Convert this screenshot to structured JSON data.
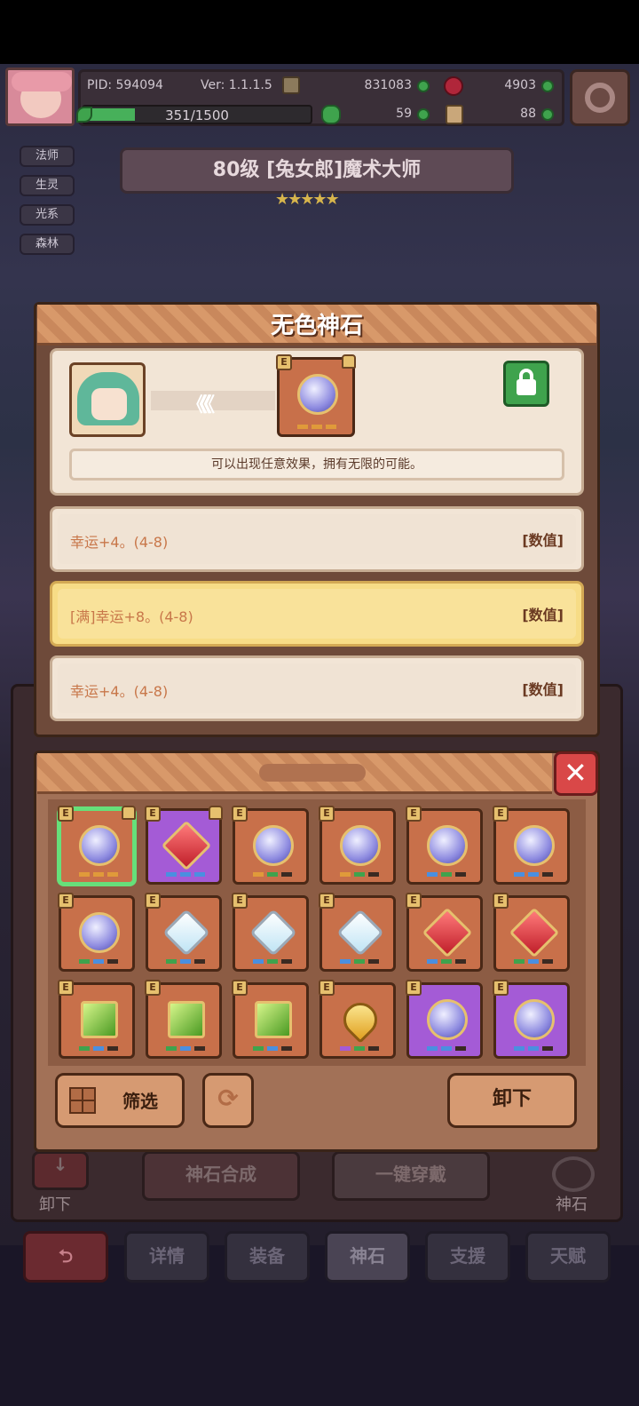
{
  "header": {
    "pid": "PID: 594094",
    "version": "Ver: 1.1.1.5",
    "gold": "831083",
    "gems": "4903",
    "xp": "351/1500",
    "clover": "59",
    "tickets": "88"
  },
  "tags": [
    "法师",
    "生灵",
    "光系",
    "森林"
  ],
  "hero_title": "80级 [兔女郎]魔术大师",
  "stars": "★★★★★",
  "stone_modal": {
    "title": "无色神石",
    "arrows": "《《《",
    "description": "可以出现任意效果，拥有无限的可能。",
    "affixes": [
      {
        "text": "幸运+4。(4-8)",
        "tag": "[数值]"
      },
      {
        "text": "[满]幸运+8。(4-8)",
        "tag": "[数值]"
      },
      {
        "text": "幸运+4。(4-8)",
        "tag": "[数值]"
      }
    ]
  },
  "inventory": {
    "badge": "E",
    "filter_label": "筛选",
    "unload_label": "卸下"
  },
  "under_layer": {
    "synthesis_label": "神石合成",
    "equip_all_label": "一键穿戴",
    "unload_label": "卸下",
    "stone_label": "神石"
  },
  "bottom_nav": [
    "详情",
    "装备",
    "神石",
    "支援",
    "天赋"
  ],
  "colors": {
    "accent_green": "#3fa34d",
    "close_red": "#d94848",
    "panel_cream": "#f2e5d6",
    "highlight_yellow": "#f7dc86"
  }
}
